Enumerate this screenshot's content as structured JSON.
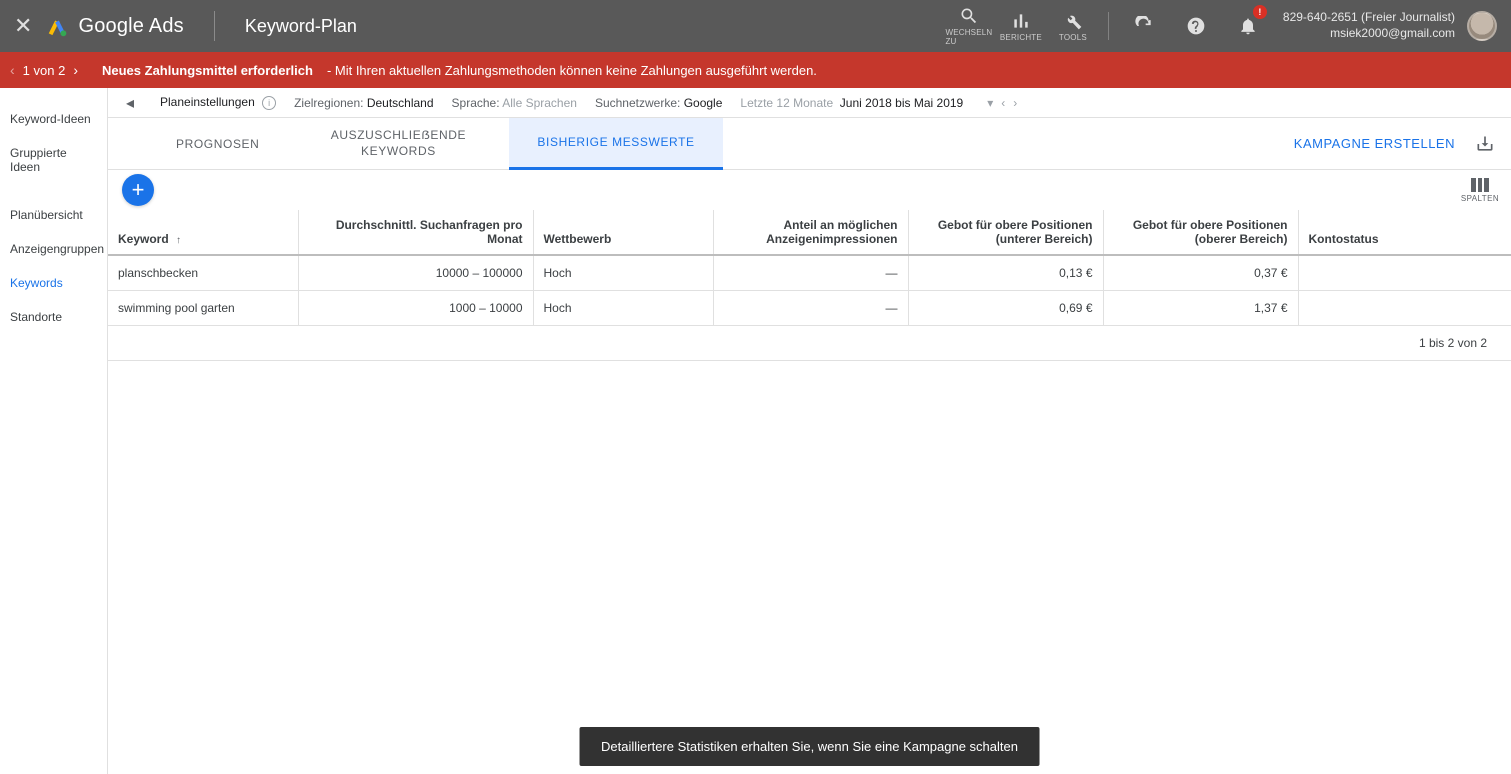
{
  "header": {
    "product": "Google Ads",
    "pageTitle": "Keyword-Plan",
    "icons": {
      "switch": {
        "label": "WECHSELN ZU"
      },
      "reports": {
        "label": "BERICHTE"
      },
      "tools": {
        "label": "TOOLS"
      }
    },
    "account": {
      "line1": "829-640-2651 (Freier Journalist)",
      "line2": "msiek2000@gmail.com"
    },
    "bellBadge": "!"
  },
  "alert": {
    "count": "1 von 2",
    "title": "Neues Zahlungsmittel erforderlich",
    "message": "- Mit Ihren aktuellen Zahlungsmethoden können keine Zahlungen ausgeführt werden."
  },
  "sidebar": {
    "items": [
      {
        "label": "Keyword-Ideen"
      },
      {
        "label": "Gruppierte Ideen"
      },
      {
        "label": "Planübersicht"
      },
      {
        "label": "Anzeigengruppen"
      },
      {
        "label": "Keywords"
      },
      {
        "label": "Standorte"
      }
    ]
  },
  "planbar": {
    "settingsLabel": "Planeinstellungen",
    "regionsLabel": "Zielregionen:",
    "regionsValue": "Deutschland",
    "languageLabel": "Sprache:",
    "languageValue": "Alle Sprachen",
    "networkLabel": "Suchnetzwerke:",
    "networkValue": "Google",
    "periodLabel": "Letzte 12 Monate",
    "periodValue": "Juni 2018 bis Mai 2019"
  },
  "tabs": {
    "prognosen": "PROGNOSEN",
    "exclude": "AUSZUSCHLIEẞENDE KEYWORDS",
    "historic": "BISHERIGE MESSWERTE",
    "createCampaign": "KAMPAGNE ERSTELLEN",
    "columns": "SPALTEN"
  },
  "table": {
    "headers": {
      "keyword": "Keyword",
      "avgSearches": "Durchschnittl. Suchanfragen pro Monat",
      "competition": "Wettbewerb",
      "impressionShare": "Anteil an möglichen Anzeigenimpressionen",
      "bidLow": "Gebot für obere Positionen (unterer Bereich)",
      "bidHigh": "Gebot für obere Positionen (oberer Bereich)",
      "accountStatus": "Kontostatus"
    },
    "rows": [
      {
        "keyword": "planschbecken",
        "avgSearches": "10000 – 100000",
        "competition": "Hoch",
        "impressionShare": "—",
        "bidLow": "0,13 €",
        "bidHigh": "0,37 €",
        "accountStatus": ""
      },
      {
        "keyword": "swimming pool garten",
        "avgSearches": "1000 – 10000",
        "competition": "Hoch",
        "impressionShare": "—",
        "bidLow": "0,69 €",
        "bidHigh": "1,37 €",
        "accountStatus": ""
      }
    ],
    "pager": "1 bis 2 von 2"
  },
  "toast": "Detailliertere Statistiken erhalten Sie, wenn Sie eine Kampagne schalten"
}
